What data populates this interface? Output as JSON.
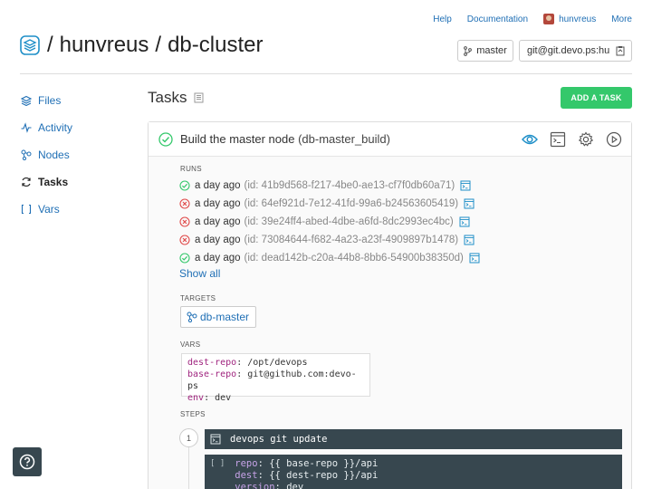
{
  "topnav": {
    "help": "Help",
    "documentation": "Documentation",
    "username": "hunvreus",
    "more": "More"
  },
  "repo": {
    "owner": "hunvreus",
    "name": "db-cluster",
    "separator": "/",
    "branch": "master",
    "clone_url": "git@git.devo.ps:hunvreus/db-cluster.git"
  },
  "sidebar": {
    "items": [
      {
        "label": "Files",
        "icon": "stack-icon"
      },
      {
        "label": "Activity",
        "icon": "pulse-icon"
      },
      {
        "label": "Nodes",
        "icon": "nodes-icon"
      },
      {
        "label": "Tasks",
        "icon": "sync-icon"
      },
      {
        "label": "Vars",
        "icon": "brackets-icon"
      }
    ],
    "active": "Tasks"
  },
  "page": {
    "title": "Tasks",
    "add_task_label": "ADD A TASK"
  },
  "task": {
    "title": "Build the master node",
    "task_id": "(db-master_build)",
    "runs_label": "RUNS",
    "runs": [
      {
        "status": "success",
        "ago": "a day ago",
        "id": "(id: 41b9d568-f217-4be0-ae13-cf7f0db60a71)"
      },
      {
        "status": "failed",
        "ago": "a day ago",
        "id": "(id: 64ef921d-7e12-41fd-99a6-b24563605419)"
      },
      {
        "status": "failed",
        "ago": "a day ago",
        "id": "(id: 39e24ff4-abed-4dbe-a6fd-8dc2993ec4bc)"
      },
      {
        "status": "failed",
        "ago": "a day ago",
        "id": "(id: 73084644-f682-4a23-a23f-4909897b1478)"
      },
      {
        "status": "success",
        "ago": "a day ago",
        "id": "(id: dead142b-c20a-44b8-8bb6-54900b38350d)"
      }
    ],
    "show_all": "Show all",
    "targets_label": "TARGETS",
    "targets": [
      "db-master"
    ],
    "vars_label": "VARS",
    "vars": [
      {
        "key": "dest-repo",
        "value": "/opt/devops"
      },
      {
        "key": "base-repo",
        "value": "git@github.com:devo-ps"
      },
      {
        "key": "env",
        "value": "dev"
      }
    ],
    "steps_label": "STEPS",
    "steps": [
      {
        "number": "1",
        "command": "devops git update",
        "bracket": "[ ]",
        "params": [
          {
            "key": "repo",
            "value": "{{ base-repo }}/api"
          },
          {
            "key": "dest",
            "value": "{{ dest-repo }}/api"
          },
          {
            "key": "version",
            "value": "dev"
          }
        ]
      }
    ]
  },
  "colors": {
    "link": "#1f6fb5",
    "success": "#34c86b",
    "failed": "#e04b4b",
    "step_bg": "#37474f"
  }
}
